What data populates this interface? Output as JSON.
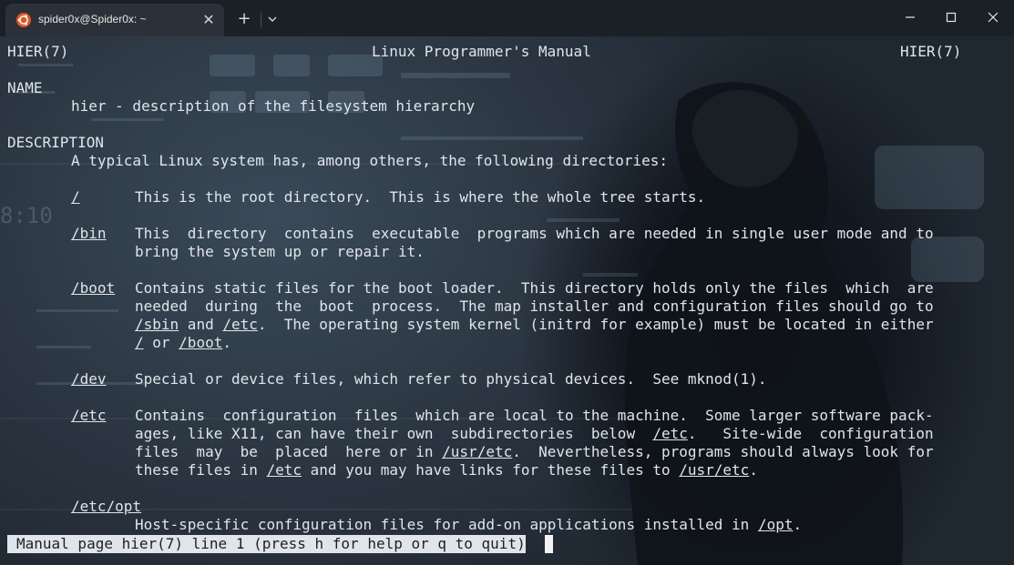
{
  "tab": {
    "title": "spider0x@Spider0x: ~",
    "close_glyph": "✕",
    "new_tab_glyph": "+",
    "icon": "ubuntu-logo-icon",
    "dropdown_icon": "chevron-down-icon"
  },
  "window_controls": [
    "minimize-icon",
    "maximize-icon",
    "close-icon"
  ],
  "colors": {
    "titlebar": "#1b2026",
    "tab": "#2a3138",
    "ubuntu_orange": "#e95420",
    "text": "#dfe5ea",
    "status_bg": "#dfe5ea"
  },
  "man": {
    "header_left": "HIER(7)",
    "header_center": "Linux Programmer's Manual",
    "header_right": "HIER(7)",
    "name_heading": "NAME",
    "name_text": "hier - description of the filesystem hierarchy",
    "desc_heading": "DESCRIPTION",
    "desc_intro": "A typical Linux system has, among others, the following directories:",
    "root_dir": "/",
    "root_text": "This is the root directory.  This is where the whole tree starts.",
    "bin_dir": "/bin",
    "bin_l1": "This  directory  contains  executable  programs which are needed in single user mode and to",
    "bin_l2": "bring the system up or repair it.",
    "boot_dir": "/boot",
    "boot_l1": "Contains static files for the boot loader.  This directory holds only the files  which  are",
    "boot_l2": "needed  during  the  boot  process.  The map installer and configuration files should go to",
    "boot_l3_link1": "/sbin",
    "boot_l3_and": " and ",
    "boot_l3_link2": "/etc",
    "boot_l3_rest": ".  The operating system kernel (initrd for example) must be located in either",
    "boot_l4_link1": "/",
    "boot_l4_or": " or ",
    "boot_l4_link2": "/boot",
    "boot_l4_end": ".",
    "dev_dir": "/dev",
    "dev_text": "Special or device files, which refer to physical devices.  See mknod(1).",
    "etc_dir": "/etc",
    "etc_l1": "Contains  configuration  files  which are local to the machine.  Some larger software pack-",
    "etc_l2_pre": "ages, like X11, can have their own  subdirectories  below  ",
    "etc_l2_link": "/etc",
    "etc_l2_post": ".   Site-wide  configuration",
    "etc_l3_pre": "files  may  be  placed  here or in ",
    "etc_l3_link": "/usr/etc",
    "etc_l3_post": ".  Nevertheless, programs should always look for",
    "etc_l4_pre": "these files in ",
    "etc_l4_link1": "/etc",
    "etc_l4_mid": " and you may have links for these files to ",
    "etc_l4_link2": "/usr/etc",
    "etc_l4_end": ".",
    "etcopt_dir": "/etc/opt",
    "etcopt_pre": "Host-specific configuration files for add-on applications installed in ",
    "etcopt_link": "/opt",
    "etcopt_end": "."
  },
  "status_bar": "Manual page hier(7) line 1 (press h for help or q to quit)"
}
